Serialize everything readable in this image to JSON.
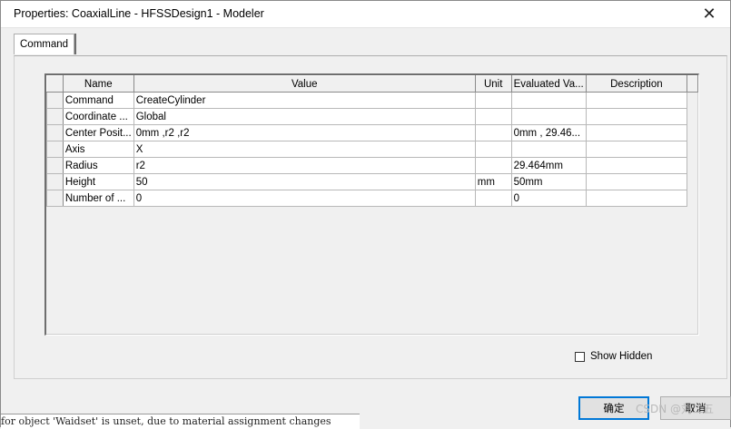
{
  "window": {
    "title": "Properties: CoaxialLine - HFSSDesign1 - Modeler",
    "close_glyph": "✕"
  },
  "tabs": [
    {
      "label": "Command",
      "active": true
    }
  ],
  "grid": {
    "columns": [
      "Name",
      "Value",
      "Unit",
      "Evaluated Va...",
      "Description"
    ],
    "rows": [
      {
        "name": "Command",
        "value": "CreateCylinder",
        "unit": "",
        "evaluated": "",
        "description": ""
      },
      {
        "name": "Coordinate ...",
        "value": "Global",
        "unit": "",
        "evaluated": "",
        "description": ""
      },
      {
        "name": "Center Posit...",
        "value": "0mm ,r2 ,r2",
        "unit": "",
        "evaluated": "0mm , 29.46...",
        "description": ""
      },
      {
        "name": "Axis",
        "value": "X",
        "unit": "",
        "evaluated": "",
        "description": ""
      },
      {
        "name": "Radius",
        "value": "r2",
        "unit": "",
        "evaluated": "29.464mm",
        "description": ""
      },
      {
        "name": "Height",
        "value": "50",
        "unit": "mm",
        "evaluated": "50mm",
        "description": ""
      },
      {
        "name": "Number of ...",
        "value": "0",
        "unit": "",
        "evaluated": "0",
        "description": ""
      }
    ]
  },
  "show_hidden": {
    "label": "Show Hidden",
    "checked": false
  },
  "buttons": {
    "ok_label": "确定",
    "cancel_label": "取消"
  },
  "watermark": "CSDN @刘二五",
  "background_text": "for object 'Waidset' is unset, due to material assignment changes"
}
